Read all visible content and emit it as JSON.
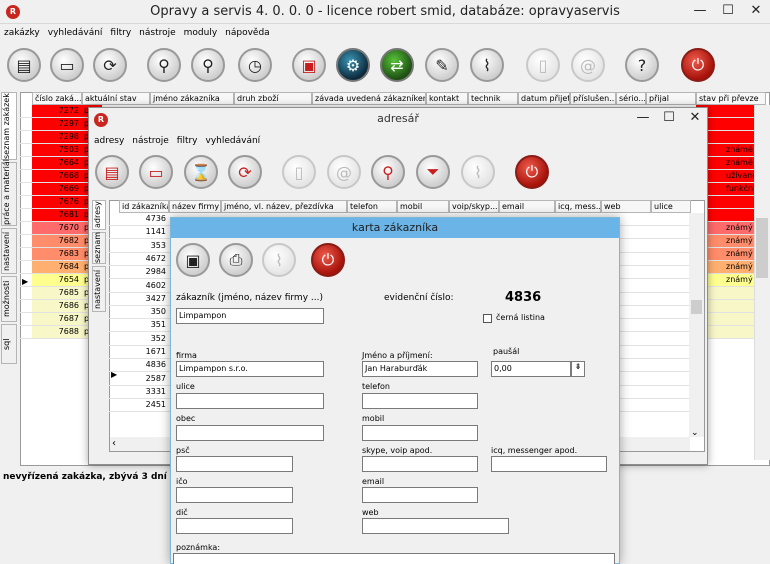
{
  "main": {
    "title": "Opravy a servis 4. 0. 0. 0 - licence robert smid, databáze: opravyaservis",
    "app_icon": "app-logo-icon",
    "menu": [
      "zakázky",
      "vyhledávání",
      "filtry",
      "nástroje",
      "moduly",
      "nápověda"
    ],
    "side_tabs": [
      "seznam zakázek",
      "práce a materiál",
      "nastavení",
      "možnosti",
      "sql"
    ],
    "columns": [
      "číslo zaká...",
      "aktuální stav",
      "jméno zákazníka",
      "druh zboží",
      "závada uvedená zákazníkem",
      "kontakt",
      "technik",
      "datum přijetí",
      "příslušen...",
      "sério...",
      "přijal",
      "stav při převze"
    ],
    "orders": [
      {
        "num": "7272",
        "color": "#ff0000",
        "right": ""
      },
      {
        "num": "7297",
        "color": "#ff0000",
        "right": ""
      },
      {
        "num": "7298",
        "color": "#ff0000",
        "right": ""
      },
      {
        "num": "7503",
        "color": "#ff0000",
        "right": "známé"
      },
      {
        "num": "7664",
        "color": "#ff0000",
        "right": "známé"
      },
      {
        "num": "7668",
        "color": "#ff0000",
        "right": "užívané"
      },
      {
        "num": "7669",
        "color": "#ff0000",
        "right": "funkční"
      },
      {
        "num": "7676",
        "color": "#ff0000",
        "right": ""
      },
      {
        "num": "7681",
        "color": "#ff0000",
        "right": ""
      },
      {
        "num": "7670",
        "color": "#ff6a6a",
        "right": "známý"
      },
      {
        "num": "7682",
        "color": "#ff8c6a",
        "right": "známý"
      },
      {
        "num": "7683",
        "color": "#ff8c6a",
        "right": "známý"
      },
      {
        "num": "7684",
        "color": "#ffb070",
        "right": "známý"
      },
      {
        "num": "7654",
        "color": "#ffff90",
        "right": "známý"
      },
      {
        "num": "7685",
        "color": "#f7f7c8",
        "right": ""
      },
      {
        "num": "7686",
        "color": "#f7f7c8",
        "right": ""
      },
      {
        "num": "7687",
        "color": "#f7f7c8",
        "right": ""
      },
      {
        "num": "7688",
        "color": "#f7f7c8",
        "right": ""
      }
    ],
    "order_prefix": "p",
    "status": "nevyřízená zakázka, zbývá 3 dní"
  },
  "adresar": {
    "title": "adresář",
    "menu": [
      "adresy",
      "nástroje",
      "filtry",
      "vyhledávání"
    ],
    "side_tabs": [
      "adresy",
      "seznam",
      "nastavení"
    ],
    "columns": [
      "id zákazníka",
      "název firmy",
      "jméno, vl. název, přezdívka",
      "telefon",
      "mobil",
      "voip/skyp...",
      "email",
      "icq, mess...",
      "web",
      "ulice"
    ],
    "ids": [
      "4736",
      "1141",
      "353",
      "4672",
      "2984",
      "4602",
      "3427",
      "350",
      "351",
      "352",
      "1671",
      "4836",
      "2587",
      "3331",
      "2451"
    ]
  },
  "karta": {
    "title": "karta zákazníka",
    "customer_label": "zákazník (jméno, název firmy ...)",
    "customer_value": "Limpampon",
    "ev_label": "evidenční číslo:",
    "ev_value": "4836",
    "blacklist_label": "černá listina",
    "firma_label": "firma",
    "firma_value": "Limpampon s.r.o.",
    "jmeno_label": "Jméno a příjmení:",
    "jmeno_value": "Jan Haraburďák",
    "pausal_label": "paušál",
    "pausal_value": "0,00",
    "ulice_label": "ulice",
    "telefon_label": "telefon",
    "obec_label": "obec",
    "mobil_label": "mobil",
    "psc_label": "psč",
    "skype_label": "skype, voip apod.",
    "icq_label": "icq, messenger apod.",
    "ico_label": "ičo",
    "email_label": "email",
    "dic_label": "dič",
    "web_label": "web",
    "poznamka_label": "poznámka:"
  }
}
